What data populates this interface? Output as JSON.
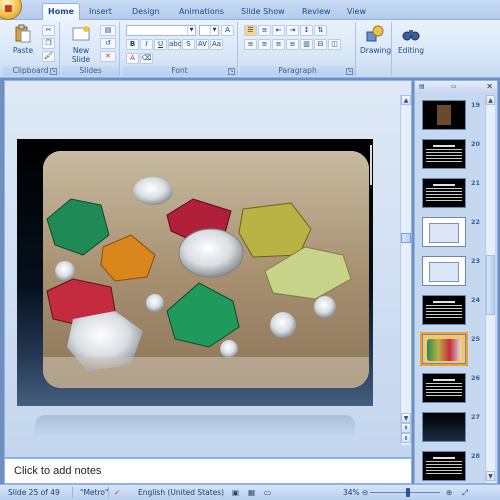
{
  "ribbon": {
    "tabs": [
      "Home",
      "Insert",
      "Design",
      "Animations",
      "Slide Show",
      "Review",
      "View"
    ],
    "active_tab": "Home",
    "groups": {
      "clipboard": {
        "label": "Clipboard",
        "paste_label": "Paste"
      },
      "slides": {
        "label": "Slides",
        "new_slide_label": "New Slide"
      },
      "font": {
        "label": "Font",
        "font_size": ""
      },
      "paragraph": {
        "label": "Paragraph"
      },
      "drawing": {
        "label": "Drawing"
      },
      "editing": {
        "label": "Editing"
      }
    }
  },
  "workspace": {
    "slide": {
      "image": "gemstones-photo"
    }
  },
  "notes": {
    "placeholder": "Click to add notes"
  },
  "thumbnails": [
    {
      "num": "19",
      "kind": "photo"
    },
    {
      "num": "20",
      "kind": "text"
    },
    {
      "num": "21",
      "kind": "text"
    },
    {
      "num": "22",
      "kind": "diagram"
    },
    {
      "num": "23",
      "kind": "diagram"
    },
    {
      "num": "24",
      "kind": "text"
    },
    {
      "num": "25",
      "kind": "photo",
      "selected": true
    },
    {
      "num": "26",
      "kind": "text"
    },
    {
      "num": "27",
      "kind": "dark"
    },
    {
      "num": "28",
      "kind": "text"
    }
  ],
  "status": {
    "slide_of": "Slide 25 of 49",
    "theme": "\"Metro\"",
    "language": "English (United States)",
    "zoom": "34%",
    "zoom_level": 0.34
  },
  "colors": {
    "ribbon_blue": "#c5d9f1",
    "accent_orange": "#f0a030",
    "text_blue": "#15428b"
  }
}
